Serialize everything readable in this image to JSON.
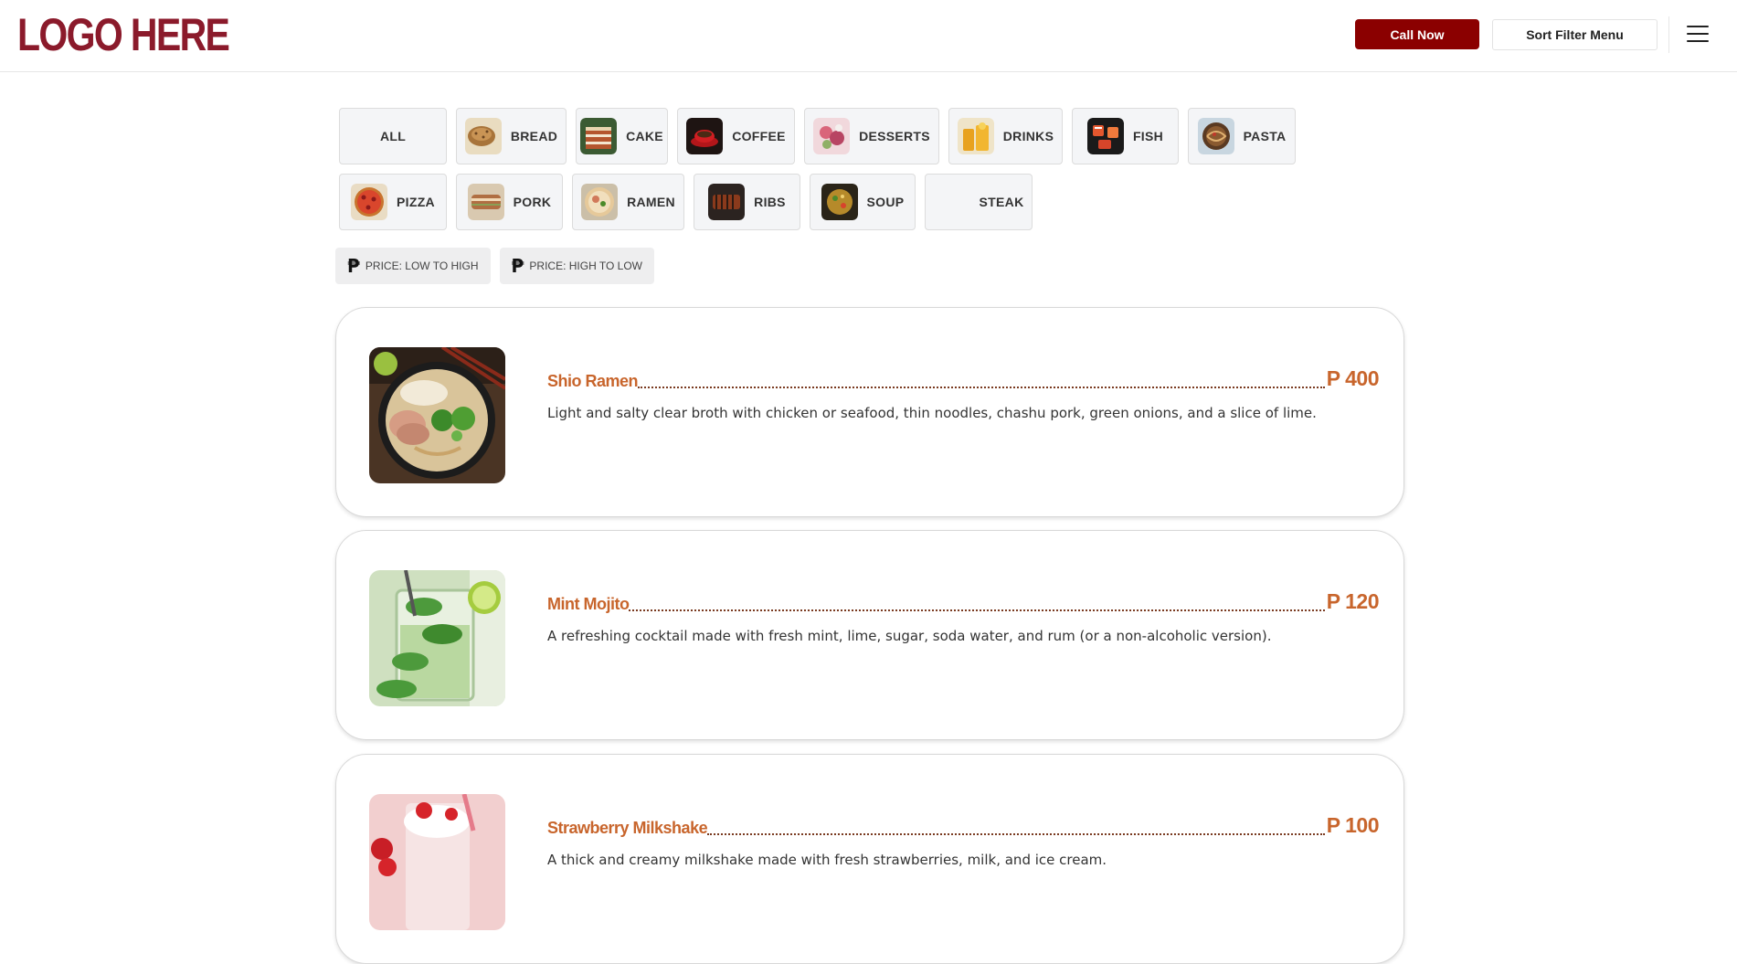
{
  "header": {
    "logo": "LOGO HERE",
    "call_label": "Call Now",
    "sort_label": "Sort Filter Menu",
    "menu_icon": "hamburger-menu-icon"
  },
  "categories": {
    "row1": [
      {
        "label": "ALL",
        "icon": null
      },
      {
        "label": "BREAD",
        "icon": "bread-thumb"
      },
      {
        "label": "CAKE",
        "icon": "cake-thumb"
      },
      {
        "label": "COFFEE",
        "icon": "coffee-thumb"
      },
      {
        "label": "DESSERTS",
        "icon": "desserts-thumb"
      },
      {
        "label": "DRINKS",
        "icon": "drinks-thumb"
      },
      {
        "label": "FISH",
        "icon": "fish-thumb"
      },
      {
        "label": "PASTA",
        "icon": "pasta-thumb"
      }
    ],
    "row2": [
      {
        "label": "PIZZA",
        "icon": "pizza-thumb"
      },
      {
        "label": "PORK",
        "icon": "pork-thumb"
      },
      {
        "label": "RAMEN",
        "icon": "ramen-thumb"
      },
      {
        "label": "RIBS",
        "icon": "ribs-thumb"
      },
      {
        "label": "SOUP",
        "icon": "soup-thumb"
      },
      {
        "label": "STEAK",
        "icon": null
      }
    ]
  },
  "price_sort": {
    "low_to_high": "PRICE: LOW TO HIGH",
    "high_to_low": "PRICE: HIGH TO LOW",
    "icon": "peso-icon"
  },
  "items": [
    {
      "name": "Shio Ramen",
      "price": "P 400",
      "description": "Light and salty clear broth with chicken or seafood, thin noodles, chashu pork, green onions, and a slice of lime."
    },
    {
      "name": "Mint Mojito",
      "price": "P 120",
      "description": " A refreshing cocktail made with fresh mint, lime, sugar, soda water, and rum (or a non-alcoholic version)."
    },
    {
      "name": "Strawberry Milkshake",
      "price": "P 100",
      "description": "A thick and creamy milkshake made with fresh strawberries, milk, and ice cream."
    }
  ],
  "colors": {
    "brand": "#8b0000",
    "logo": "#8b1a2b",
    "accent": "#c8652c"
  }
}
